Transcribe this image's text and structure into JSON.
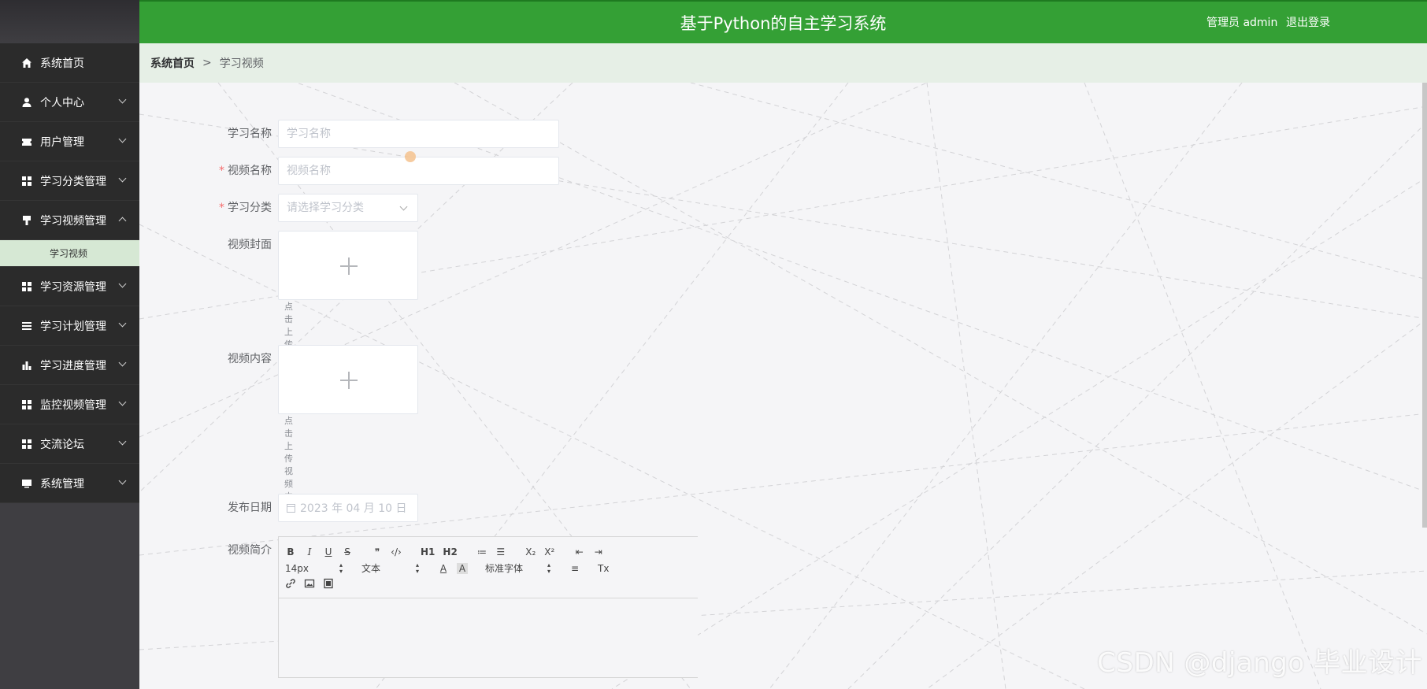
{
  "header": {
    "title": "基于Python的自主学习系统",
    "user_label": "管理员 admin",
    "logout_label": "退出登录"
  },
  "sidebar": {
    "items": [
      {
        "label": "系统首页",
        "icon": "home-icon"
      },
      {
        "label": "个人中心",
        "icon": "user-icon"
      },
      {
        "label": "用户管理",
        "icon": "ticket-icon"
      },
      {
        "label": "学习分类管理",
        "icon": "grid-icon"
      },
      {
        "label": "学习视频管理",
        "icon": "brush-icon",
        "expanded": true
      },
      {
        "label": "学习资源管理",
        "icon": "grid-icon"
      },
      {
        "label": "学习计划管理",
        "icon": "list-icon"
      },
      {
        "label": "学习进度管理",
        "icon": "bar-chart-icon"
      },
      {
        "label": "监控视频管理",
        "icon": "grid-icon"
      },
      {
        "label": "交流论坛",
        "icon": "grid-icon"
      },
      {
        "label": "系统管理",
        "icon": "monitor-icon"
      }
    ],
    "submenu_active": "学习视频"
  },
  "breadcrumb": {
    "home": "系统首页",
    "separator": ">",
    "current": "学习视频"
  },
  "form": {
    "study_name": {
      "label": "学习名称",
      "placeholder": "学习名称",
      "value": ""
    },
    "video_name": {
      "label": "视频名称",
      "placeholder": "视频名称",
      "value": "",
      "required": true
    },
    "category": {
      "label": "学习分类",
      "placeholder": "请选择学习分类",
      "required": true
    },
    "cover": {
      "label": "视频封面",
      "tip": "点击上传视频封面"
    },
    "content": {
      "label": "视频内容",
      "tip": "点击上传视频内容"
    },
    "publish_date": {
      "label": "发布日期",
      "value": "2023 年 04 月 10 日"
    },
    "intro": {
      "label": "视频简介"
    }
  },
  "editor": {
    "toolbar_row1": [
      "B",
      "I",
      "U",
      "S",
      "❞",
      "‹/›",
      "H1",
      "H2",
      "≔",
      "☰",
      "X₂",
      "X²",
      "⇤",
      "⇥"
    ],
    "font_size": "14px",
    "text_style": "文本",
    "font_family": "标准字体",
    "text_color_icon": "A",
    "bg_color_icon": "A",
    "clear_format_icon": "Tx"
  },
  "watermark": "CSDN @django 毕业设计",
  "colors": {
    "header": "#34a035",
    "sidebar": "#2b2b2b",
    "submenu_active_bg": "#d6e8d4",
    "breadcrumb_bg": "#e6efe6",
    "required": "#f56c6c"
  }
}
